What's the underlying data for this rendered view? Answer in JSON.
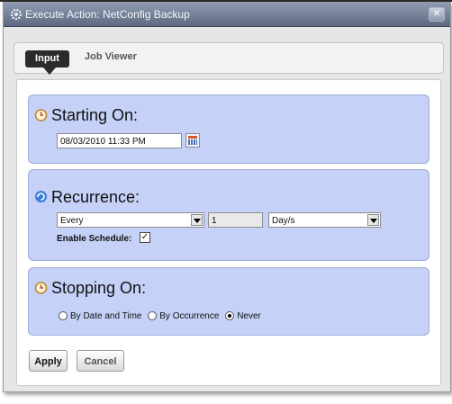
{
  "window": {
    "title": "Execute Action: NetConfig Backup",
    "close_glyph": "✕"
  },
  "tabs": {
    "input": "Input",
    "job_viewer": "Job Viewer"
  },
  "starting": {
    "title": "Starting On:",
    "datetime": "08/03/2010 11:33 PM",
    "icon": "clock-icon"
  },
  "recurrence": {
    "title": "Recurrence:",
    "icon": "refresh-icon",
    "mode": "Every",
    "interval": "1",
    "unit": "Day/s",
    "enable_label": "Enable Schedule:",
    "enable_checked": "✓"
  },
  "stopping": {
    "title": "Stopping On:",
    "icon": "clock-icon",
    "options": [
      "By Date and Time",
      "By Occurrence",
      "Never"
    ],
    "selected": "Never"
  },
  "buttons": {
    "apply": "Apply",
    "cancel": "Cancel"
  },
  "colors": {
    "panel": "#c5d1f7",
    "titlebar": "#6e7a91",
    "accent": "#2b2b2b"
  }
}
